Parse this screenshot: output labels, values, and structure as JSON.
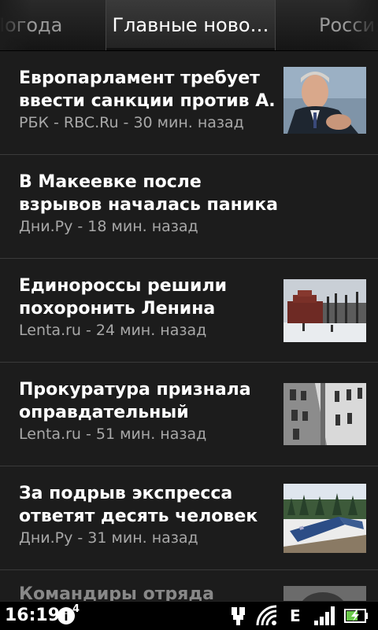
{
  "tabs": [
    {
      "label": "Погода"
    },
    {
      "label": "Главные ново…"
    },
    {
      "label": "Россия"
    }
  ],
  "news": [
    {
      "headline": "Европарламент требует ввести санкции против А.",
      "source": "РБК - RBC.Ru - 30 мин. назад",
      "thumb": "portrait-photo"
    },
    {
      "headline": "В Макеевке после взрывов началась паника",
      "source": "Дни.Ру - 18 мин. назад",
      "thumb": null
    },
    {
      "headline": "Единороссы решили похоронить Ленина",
      "source": "Lenta.ru - 24 мин. назад",
      "thumb": "mausoleum-photo"
    },
    {
      "headline": "Прокуратура признала оправдательный",
      "source": "Lenta.ru - 51 мин. назад",
      "thumb": "building-photo"
    },
    {
      "headline": "За подрыв экспресса ответят десять человек",
      "source": "Дни.Ру - 31 мин. назад",
      "thumb": "train-photo"
    },
    {
      "headline": "Командиры отряда ОМОН",
      "source": "",
      "thumb": "partial-photo"
    }
  ],
  "statusbar": {
    "time": "16:19",
    "notification_count": "4",
    "network": "E",
    "icons": [
      "clock",
      "notification-icon",
      "usb-icon",
      "wifi-icon",
      "edge-network-icon",
      "signal-icon",
      "battery-icon"
    ]
  }
}
